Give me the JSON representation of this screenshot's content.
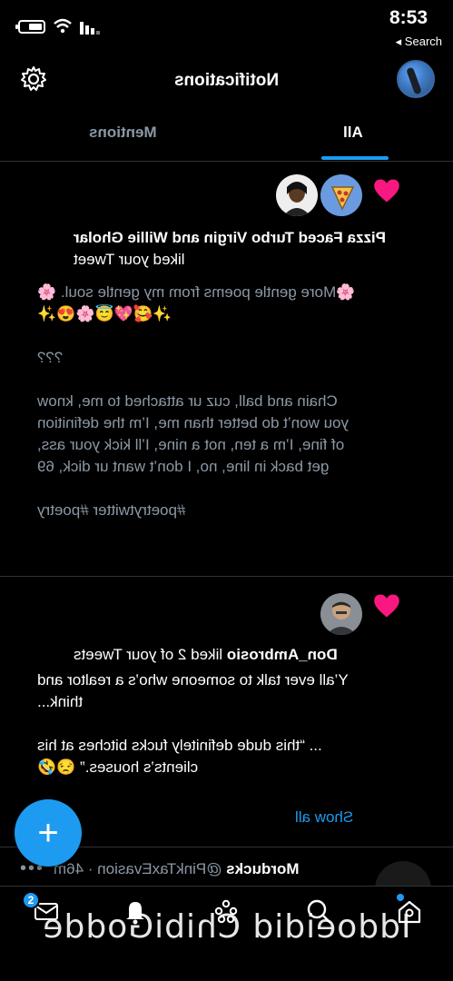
{
  "status": {
    "time": "8:53",
    "back_label": "◂ Search"
  },
  "header": {
    "title": "Notifications"
  },
  "tabs": [
    {
      "label": "Mentions"
    },
    {
      "label": "All"
    }
  ],
  "notifications": [
    {
      "actors": "Pizza Faced Turbo Virgin and Willie Gholar",
      "action": "liked your Tweet",
      "text": "🌸More gentle poems from my gentle soul. 🌸✨🥰💖😇🌸😍✨\n\n???\n\nChain and ball, cuz ur attached to me, know you won’t do better than me, I’m the definition of fine, I’m a ten, not a nine, I’ll kick your ass, get back in line, no, I don’t want ur dick, 69\n\n#poetrytwitter #poetry"
    },
    {
      "actors": "Don_Ambrosio",
      "action": "liked 2 of your Tweets",
      "text": "Y’all ever talk to someone who’s a realtor and think...\n\n... “this dude definitely fucks bitches at his clients’s houses.” 😒🤣",
      "show_all": "Show all"
    }
  ],
  "partial": {
    "name": "Morducks",
    "handle": "@PinkTaxEvasion · 46m",
    "dots": "•••"
  },
  "bottom_nav": {
    "messages_badge": "2"
  },
  "watermark": "Iddoeidid ChibiGodde"
}
